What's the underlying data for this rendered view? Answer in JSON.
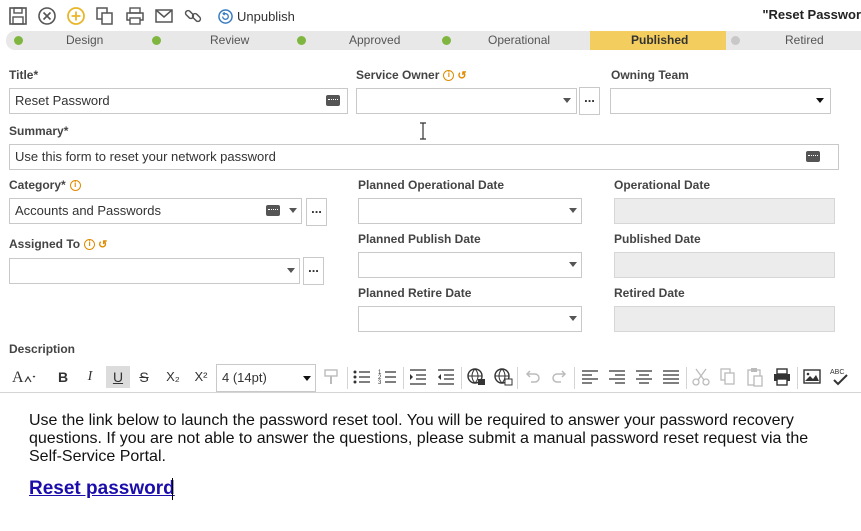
{
  "toolbar": {
    "icons": [
      "save-icon",
      "cancel-icon",
      "add-icon",
      "copy-icon",
      "print-icon",
      "email-icon",
      "link-icon"
    ],
    "unpublish_label": "Unpublish",
    "document_title": "\"Reset Passwor"
  },
  "lifecycle": {
    "stages": [
      "Design",
      "Review",
      "Approved",
      "Operational",
      "Published",
      "Retired"
    ],
    "active": "Published",
    "colors": {
      "completed_dot": "#7fb640",
      "active_bg": "#f3cd5e",
      "pending_dot": "#c8c8c8"
    }
  },
  "form": {
    "title_label": "Title*",
    "title_value": "Reset Password",
    "service_owner_label": "Service Owner",
    "service_owner_value": "",
    "owning_team_label": "Owning Team",
    "owning_team_value": "",
    "summary_label": "Summary*",
    "summary_value": "Use this form to reset your network password",
    "category_label": "Category*",
    "category_value": "Accounts and Passwords",
    "assigned_to_label": "Assigned To",
    "assigned_to_value": "",
    "planned_operational_label": "Planned Operational Date",
    "operational_label": "Operational Date",
    "planned_publish_label": "Planned Publish Date",
    "published_label": "Published Date",
    "planned_retire_label": "Planned Retire Date",
    "retired_label": "Retired Date",
    "ellipsis": "..."
  },
  "description": {
    "label": "Description",
    "font_size_value": "4 (14pt)",
    "body_text": "Use the link below to launch the password reset tool. You will be required to answer your password recovery questions. If you are not able to answer the questions, please submit a manual password reset request via the Self-Service Portal.",
    "link_text": "Reset password",
    "toolbar_buttons": {
      "bold": "B",
      "italic": "I",
      "underline": "U",
      "strike": "S",
      "subscript": "X₂",
      "superscript": "X²"
    }
  }
}
